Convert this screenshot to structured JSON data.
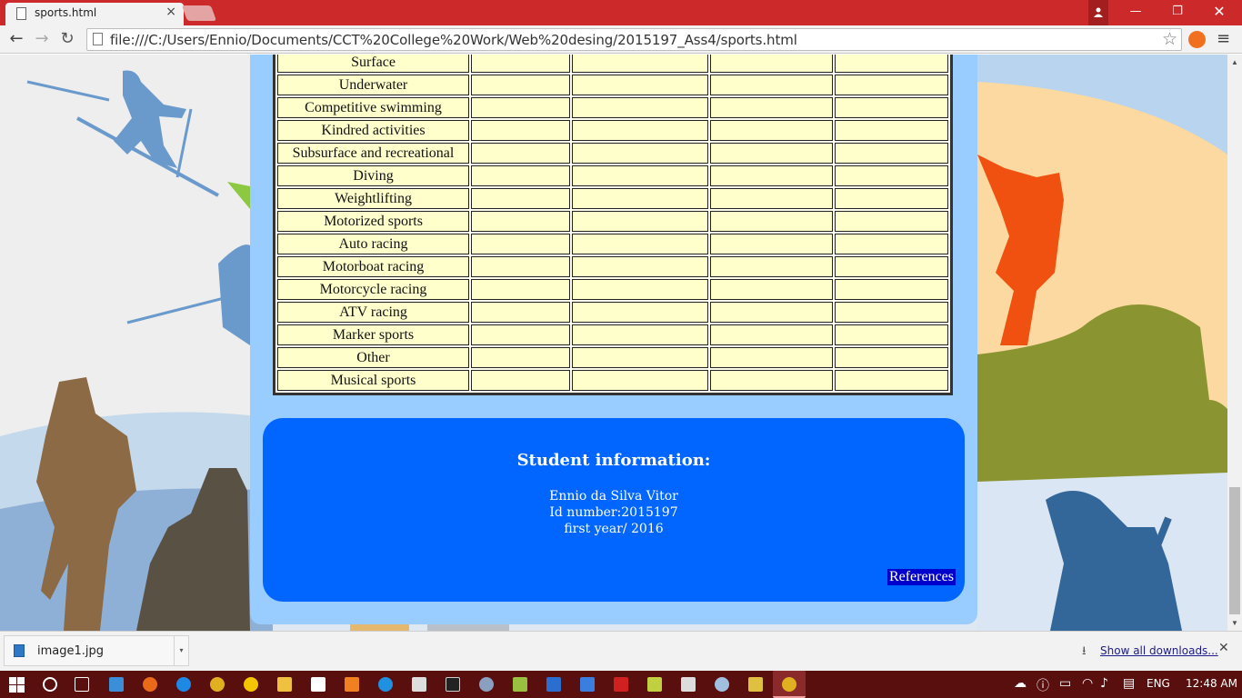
{
  "browser": {
    "tab_title": "sports.html",
    "tab_close": "×",
    "url": "file:///C:/Users/Ennio/Documents/CCT%20College%20Work/Web%20desing/2015197_Ass4/sports.html",
    "window_controls": {
      "minimize": "—",
      "maximize": "❐",
      "close": "✕"
    },
    "nav": {
      "back": "←",
      "forward": "→",
      "reload": "↻"
    },
    "star": "☆",
    "menu": "≡"
  },
  "table": {
    "rows": [
      [
        "Surface",
        "",
        "",
        "",
        ""
      ],
      [
        "Underwater",
        "",
        "",
        "",
        ""
      ],
      [
        "Competitive swimming",
        "",
        "",
        "",
        ""
      ],
      [
        "Kindred activities",
        "",
        "",
        "",
        ""
      ],
      [
        "Subsurface and recreational",
        "",
        "",
        "",
        ""
      ],
      [
        "Diving",
        "",
        "",
        "",
        ""
      ],
      [
        "Weightlifting",
        "",
        "",
        "",
        ""
      ],
      [
        "Motorized sports",
        "",
        "",
        "",
        ""
      ],
      [
        "Auto racing",
        "",
        "",
        "",
        ""
      ],
      [
        "Motorboat racing",
        "",
        "",
        "",
        ""
      ],
      [
        "Motorcycle racing",
        "",
        "",
        "",
        ""
      ],
      [
        "ATV racing",
        "",
        "",
        "",
        ""
      ],
      [
        "Marker sports",
        "",
        "",
        "",
        ""
      ],
      [
        "Other",
        "",
        "",
        "",
        ""
      ],
      [
        "Musical sports",
        "",
        "",
        "",
        ""
      ]
    ]
  },
  "student": {
    "heading": "Student information:",
    "name": "Ennio da Silva Vitor",
    "id": "Id number:2015197",
    "year": "first year/ 2016",
    "references": "References"
  },
  "downloads": {
    "file_name": "image1.jpg",
    "caret": "▾",
    "show_all": "Show all downloads...",
    "close": "✕"
  },
  "taskbar": {
    "language": "ENG",
    "time": "12:48 AM"
  },
  "colors": {
    "title_bar": "#cc2a2a",
    "panel": "#99ccff",
    "student_box": "#0066ff",
    "table_cell": "#ffffcc",
    "references_bg": "#0000cc",
    "taskbar": "#5a0f0f"
  }
}
